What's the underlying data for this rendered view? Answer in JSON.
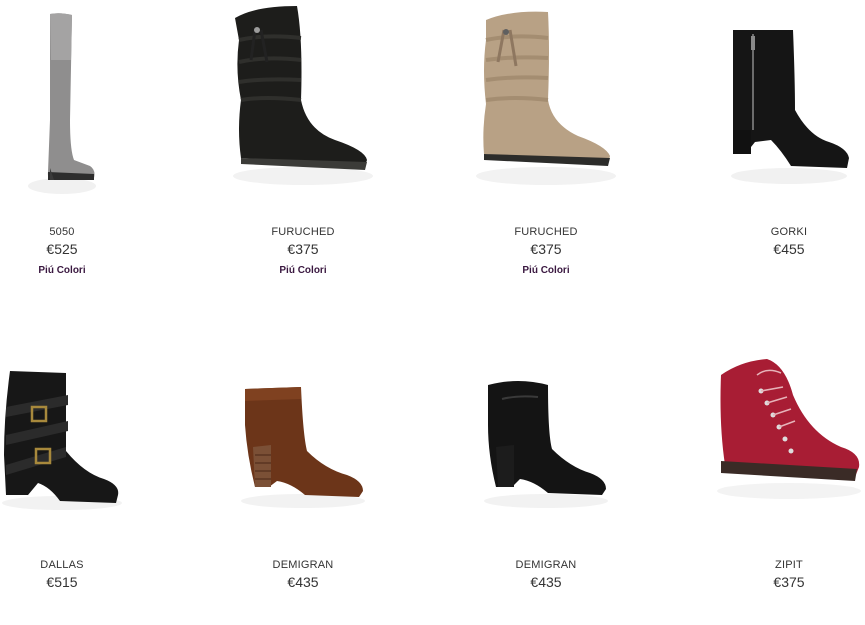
{
  "products": [
    {
      "name": "5050",
      "price": "€525",
      "more_colors": "Piú Colori",
      "image": "grey over-the-knee boot"
    },
    {
      "name": "FURUCHED",
      "price": "€375",
      "more_colors": "Piú Colori",
      "image": "black slouch suede boot with tassel"
    },
    {
      "name": "FURUCHED",
      "price": "€375",
      "more_colors": "Piú Colori",
      "image": "taupe slouch suede boot with tassel"
    },
    {
      "name": "GORKI",
      "price": "€455",
      "more_colors": "",
      "image": "black suede ankle boot with side zip"
    },
    {
      "name": "DALLAS",
      "price": "€515",
      "more_colors": "",
      "image": "black leather buckle strap boot"
    },
    {
      "name": "DEMIGRAN",
      "price": "€435",
      "more_colors": "",
      "image": "brown leather ankle bootie"
    },
    {
      "name": "DEMIGRAN",
      "price": "€435",
      "more_colors": "",
      "image": "black leather ankle bootie"
    },
    {
      "name": "ZIPIT",
      "price": "€375",
      "more_colors": "",
      "image": "red suede lace-up sneaker"
    }
  ],
  "colors": {
    "link": "#3a1840",
    "text": "#333333"
  }
}
